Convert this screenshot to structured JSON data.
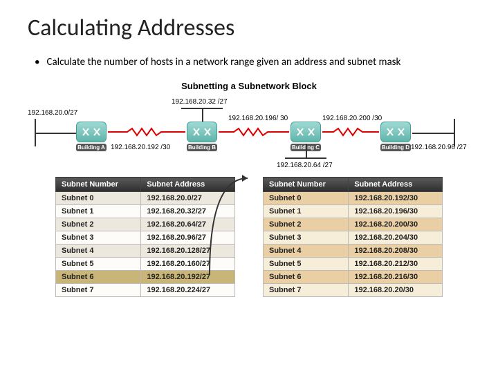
{
  "title": "Calculating Addresses",
  "bullet": "Calculate the number of hosts in a network range given an address and subnet mask",
  "diagram": {
    "title": "Subnetting a Subnetwork Block",
    "labels": {
      "left_net": "192.168.20.0/27",
      "top_center": "192.168.20.32 /27",
      "link_bc": "192.168.20.196/ 30",
      "link_cd": "192.168.20.200 /30",
      "link_ab_below": "192.168.20.192 /30",
      "below_c": "192.168.20.64 /27",
      "right_net": "192.168.20.96 /27"
    },
    "routers": [
      "Building A",
      "Building B",
      "Building C",
      "Building D"
    ]
  },
  "table1": {
    "headers": [
      "Subnet Number",
      "Subnet Address"
    ],
    "rows": [
      [
        "Subnet 0",
        "192.168.20.0/27"
      ],
      [
        "Subnet 1",
        "192.168.20.32/27"
      ],
      [
        "Subnet 2",
        "192.168.20.64/27"
      ],
      [
        "Subnet 3",
        "192.168.20.96/27"
      ],
      [
        "Subnet 4",
        "192.168.20.128/27"
      ],
      [
        "Subnet 5",
        "192.168.20.160/27"
      ],
      [
        "Subnet 6",
        "192.168.20.192/27"
      ],
      [
        "Subnet 7",
        "192.168.20.224/27"
      ]
    ],
    "highlight_row": 6
  },
  "table2": {
    "headers": [
      "Subnet Number",
      "Subnet Address"
    ],
    "rows": [
      [
        "Subnet 0",
        "192.168.20.192/30"
      ],
      [
        "Subnet 1",
        "192.168.20.196/30"
      ],
      [
        "Subnet 2",
        "192.168.20.200/30"
      ],
      [
        "Subnet 3",
        "192.168.20.204/30"
      ],
      [
        "Subnet 4",
        "192.168.20.208/30"
      ],
      [
        "Subnet 5",
        "192.168.20.212/30"
      ],
      [
        "Subnet 6",
        "192.168.20.216/30"
      ],
      [
        "Subnet 7",
        "192.168.20.20/30"
      ]
    ]
  }
}
